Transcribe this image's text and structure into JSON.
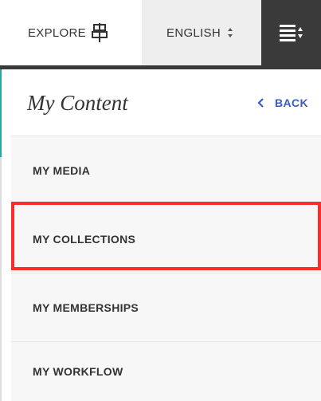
{
  "topbar": {
    "explore_label": "EXPLORE",
    "explore_icon": "explore-glyph-icon",
    "language_label": "ENGLISH",
    "language_icon": "updown-arrows-icon",
    "menu_icon": "menu-list-icon"
  },
  "panel": {
    "title": "My Content",
    "back_label": "BACK",
    "back_icon": "chevron-left-icon",
    "items": [
      {
        "label": "MY MEDIA"
      },
      {
        "label": "MY COLLECTIONS"
      },
      {
        "label": "MY MEMBERSHIPS"
      },
      {
        "label": "MY WORKFLOW"
      }
    ]
  },
  "colors": {
    "accent_link": "#3b5cc4",
    "highlight": "#ff2a2a",
    "menu_bg": "#3a3a3a"
  }
}
